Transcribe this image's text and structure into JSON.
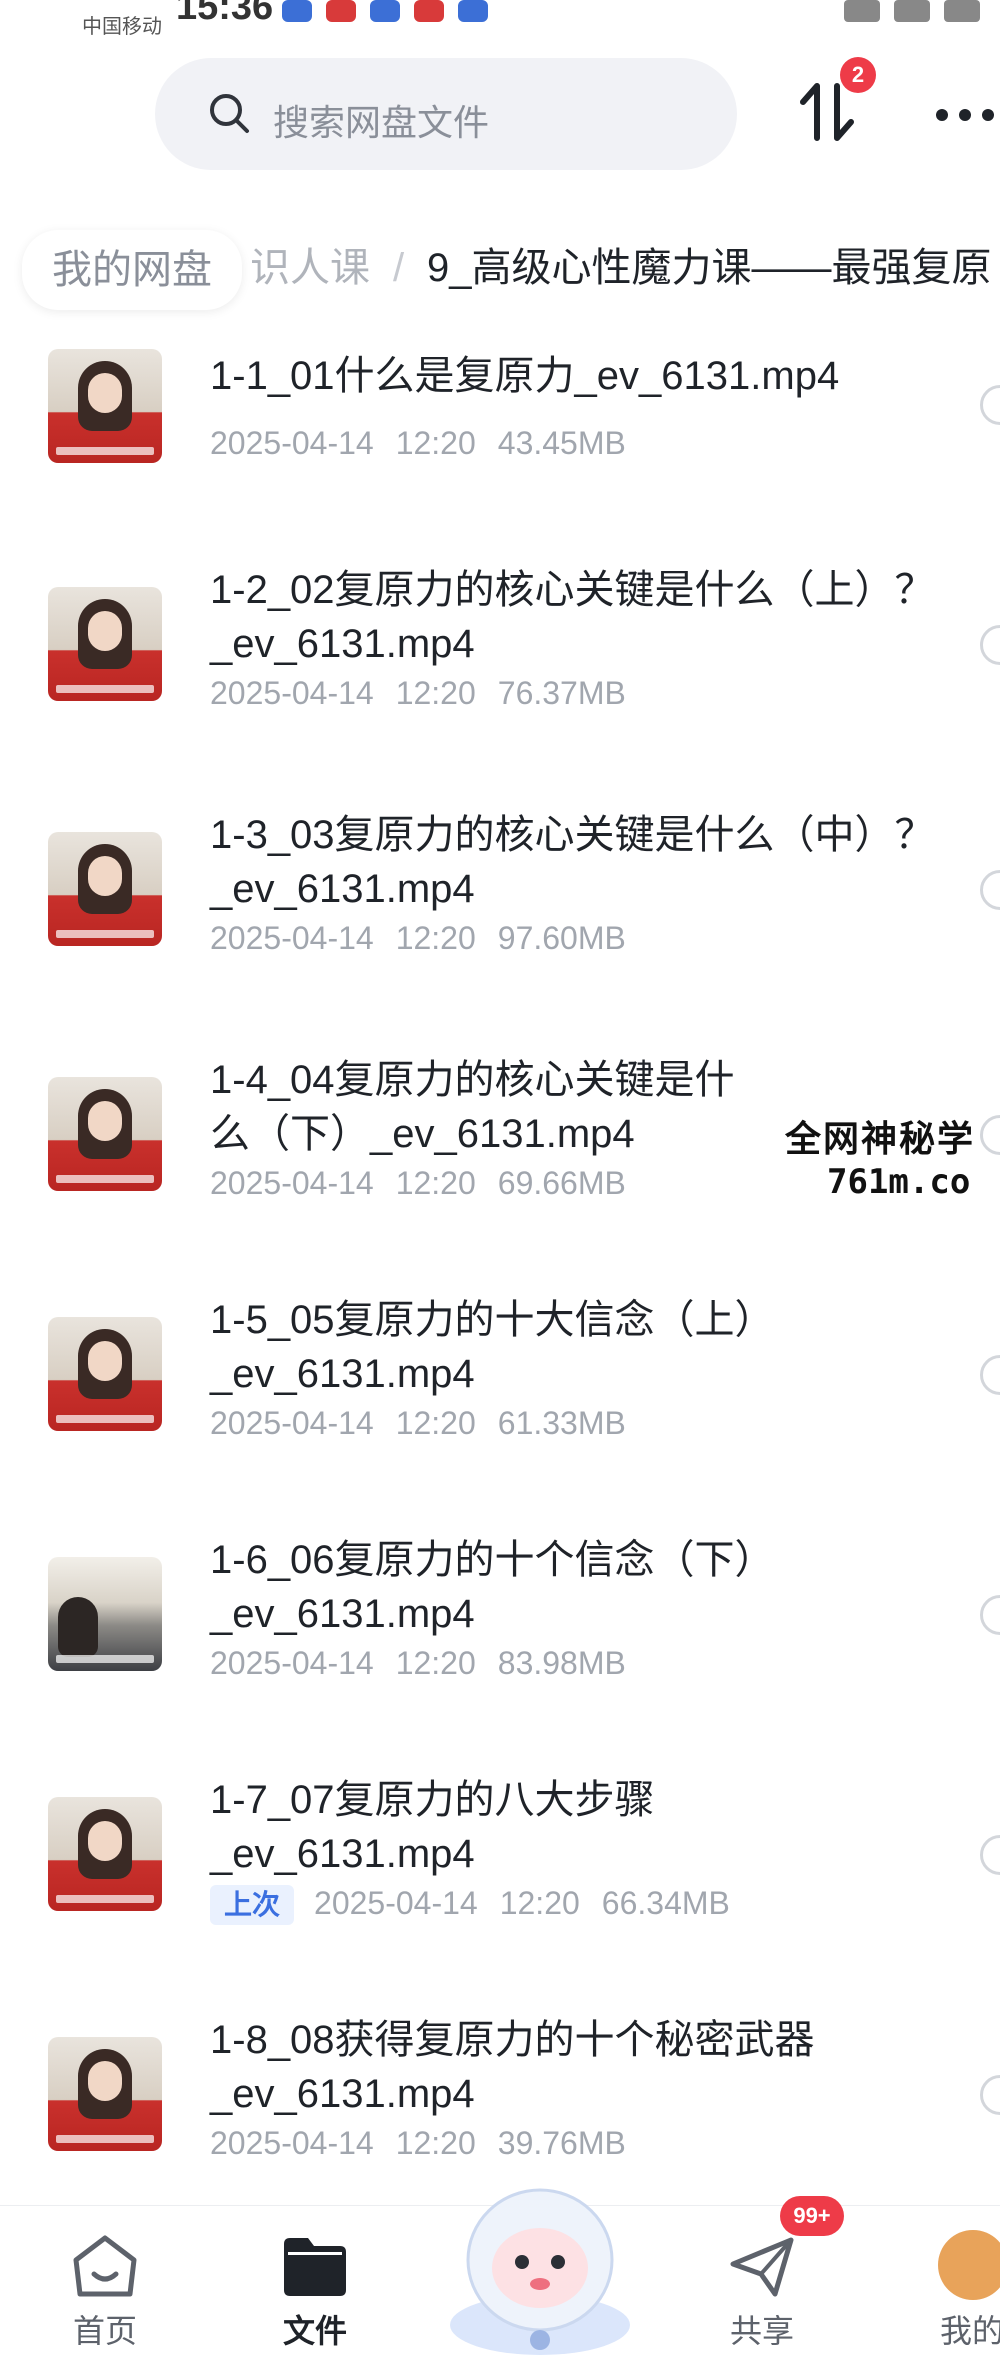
{
  "status_bar": {
    "carrier": "中国移动",
    "time": "15:36"
  },
  "search": {
    "placeholder": "搜索网盘文件",
    "transfer_badge": "2"
  },
  "breadcrumb": {
    "root": "我的网盘",
    "middle": "识人课",
    "separator": "/",
    "current": "9_高级心性魔力课——最强复原"
  },
  "files": [
    {
      "name": "1-1_01什么是复原力_ev_6131.mp4",
      "date": "2025-04-14",
      "time": "12:20",
      "size": "43.45MB",
      "tag": ""
    },
    {
      "name": "1-2_02复原力的核心关键是什么（上）？_ev_6131.mp4",
      "date": "2025-04-14",
      "time": "12:20",
      "size": "76.37MB",
      "tag": ""
    },
    {
      "name": "1-3_03复原力的核心关键是什么（中）？_ev_6131.mp4",
      "date": "2025-04-14",
      "time": "12:20",
      "size": "97.60MB",
      "tag": ""
    },
    {
      "name": "1-4_04复原力的核心关键是什么（下）_ev_6131.mp4",
      "date": "2025-04-14",
      "time": "12:20",
      "size": "69.66MB",
      "tag": ""
    },
    {
      "name": "1-5_05复原力的十大信念（上）_ev_6131.mp4",
      "date": "2025-04-14",
      "time": "12:20",
      "size": "61.33MB",
      "tag": ""
    },
    {
      "name": "1-6_06复原力的十个信念（下）_ev_6131.mp4",
      "date": "2025-04-14",
      "time": "12:20",
      "size": "83.98MB",
      "tag": ""
    },
    {
      "name": "1-7_07复原力的八大步骤_ev_6131.mp4",
      "date": "2025-04-14",
      "time": "12:20",
      "size": "66.34MB",
      "tag": "上次"
    },
    {
      "name": "1-8_08获得复原力的十个秘密武器_ev_6131.mp4",
      "date": "2025-04-14",
      "time": "12:20",
      "size": "39.76MB",
      "tag": ""
    }
  ],
  "watermark": {
    "line1": "全网神秘学",
    "line2": "761m.co"
  },
  "nav": {
    "home": "首页",
    "files": "文件",
    "share": "共享",
    "share_badge": "99+",
    "mine": "我的"
  },
  "colors": {
    "accent": "#3b6fe0",
    "badge": "#ee3b48",
    "text_primary": "#1f2329",
    "text_secondary": "#a1a6ae"
  }
}
